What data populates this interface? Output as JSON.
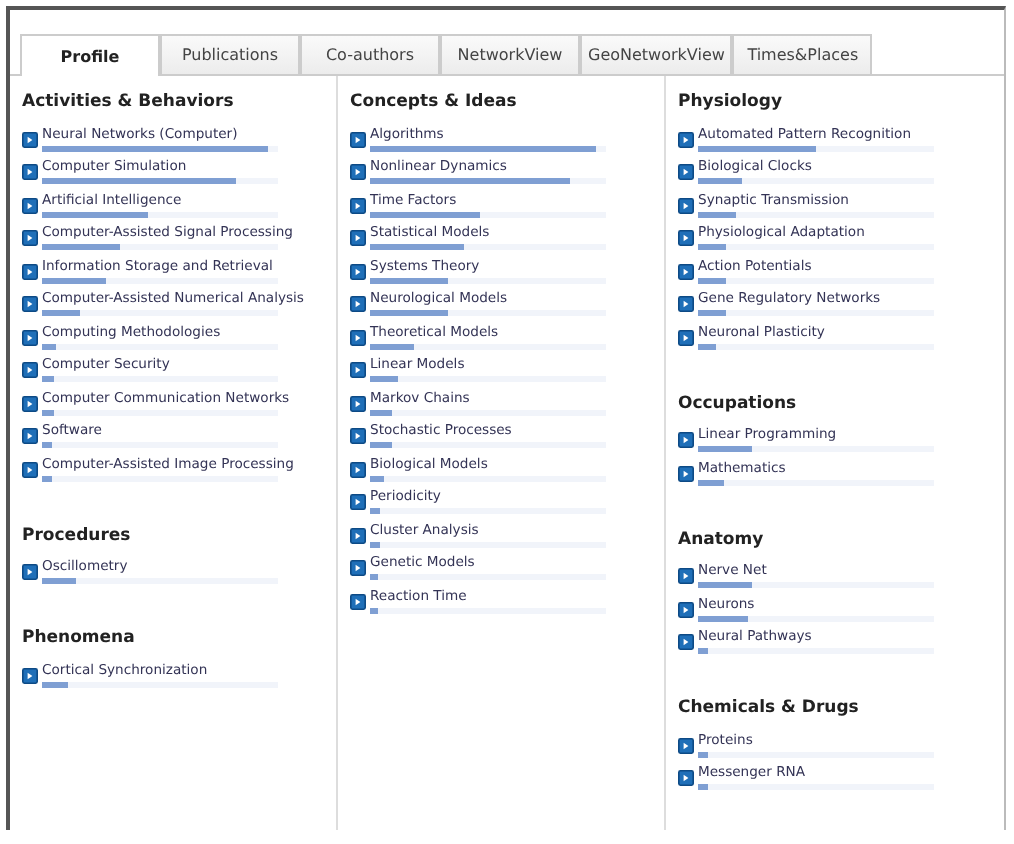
{
  "tabs": [
    {
      "label": "Profile",
      "selected": true
    },
    {
      "label": "Publications",
      "selected": false
    },
    {
      "label": "Co-authors",
      "selected": false
    },
    {
      "label": "NetworkView",
      "selected": false
    },
    {
      "label": "GeoNetworkView",
      "selected": false
    },
    {
      "label": "Times&Places",
      "selected": false
    }
  ],
  "columns": [
    {
      "sections": [
        {
          "heading": "Activities & Behaviors",
          "items": [
            {
              "label": "Neural Networks (Computer)",
              "level": 0.96
            },
            {
              "label": "Computer Simulation",
              "level": 0.82
            },
            {
              "label": "Artificial Intelligence",
              "level": 0.45
            },
            {
              "label": "Computer-Assisted Signal Processing",
              "level": 0.33
            },
            {
              "label": "Information Storage and Retrieval",
              "level": 0.27
            },
            {
              "label": "Computer-Assisted Numerical Analysis",
              "level": 0.16
            },
            {
              "label": "Computing Methodologies",
              "level": 0.06
            },
            {
              "label": "Computer Security",
              "level": 0.05
            },
            {
              "label": "Computer Communication Networks",
              "level": 0.05
            },
            {
              "label": "Software",
              "level": 0.04
            },
            {
              "label": "Computer-Assisted Image Processing",
              "level": 0.04
            }
          ]
        },
        {
          "heading": "Procedures",
          "items": [
            {
              "label": "Oscillometry",
              "level": 0.14
            }
          ]
        },
        {
          "heading": "Phenomena",
          "items": [
            {
              "label": "Cortical Synchronization",
              "level": 0.11
            }
          ]
        }
      ]
    },
    {
      "sections": [
        {
          "heading": "Concepts & Ideas",
          "items": [
            {
              "label": "Algorithms",
              "level": 0.96
            },
            {
              "label": "Nonlinear Dynamics",
              "level": 0.85
            },
            {
              "label": "Time Factors",
              "level": 0.47
            },
            {
              "label": "Statistical Models",
              "level": 0.4
            },
            {
              "label": "Systems Theory",
              "level": 0.33
            },
            {
              "label": "Neurological Models",
              "level": 0.33
            },
            {
              "label": "Theoretical Models",
              "level": 0.19
            },
            {
              "label": "Linear Models",
              "level": 0.12
            },
            {
              "label": "Markov Chains",
              "level": 0.09
            },
            {
              "label": "Stochastic Processes",
              "level": 0.09
            },
            {
              "label": "Biological Models",
              "level": 0.06
            },
            {
              "label": "Periodicity",
              "level": 0.04
            },
            {
              "label": "Cluster Analysis",
              "level": 0.04
            },
            {
              "label": "Genetic Models",
              "level": 0.03
            },
            {
              "label": "Reaction Time",
              "level": 0.03
            }
          ]
        }
      ]
    },
    {
      "sections": [
        {
          "heading": "Physiology",
          "items": [
            {
              "label": "Automated Pattern Recognition",
              "level": 0.5
            },
            {
              "label": "Biological Clocks",
              "level": 0.19
            },
            {
              "label": "Synaptic Transmission",
              "level": 0.16
            },
            {
              "label": "Physiological Adaptation",
              "level": 0.12
            },
            {
              "label": "Action Potentials",
              "level": 0.12
            },
            {
              "label": "Gene Regulatory Networks",
              "level": 0.12
            },
            {
              "label": "Neuronal Plasticity",
              "level": 0.08
            }
          ]
        },
        {
          "heading": "Occupations",
          "items": [
            {
              "label": "Linear Programming",
              "level": 0.23
            },
            {
              "label": "Mathematics",
              "level": 0.11
            }
          ]
        },
        {
          "heading": "Anatomy",
          "items": [
            {
              "label": "Nerve Net",
              "level": 0.23
            },
            {
              "label": "Neurons",
              "level": 0.21
            },
            {
              "label": "Neural Pathways",
              "level": 0.04
            }
          ]
        },
        {
          "heading": "Chemicals & Drugs",
          "items": [
            {
              "label": "Proteins",
              "level": 0.04
            },
            {
              "label": "Messenger RNA",
              "level": 0.04
            }
          ]
        }
      ]
    }
  ]
}
